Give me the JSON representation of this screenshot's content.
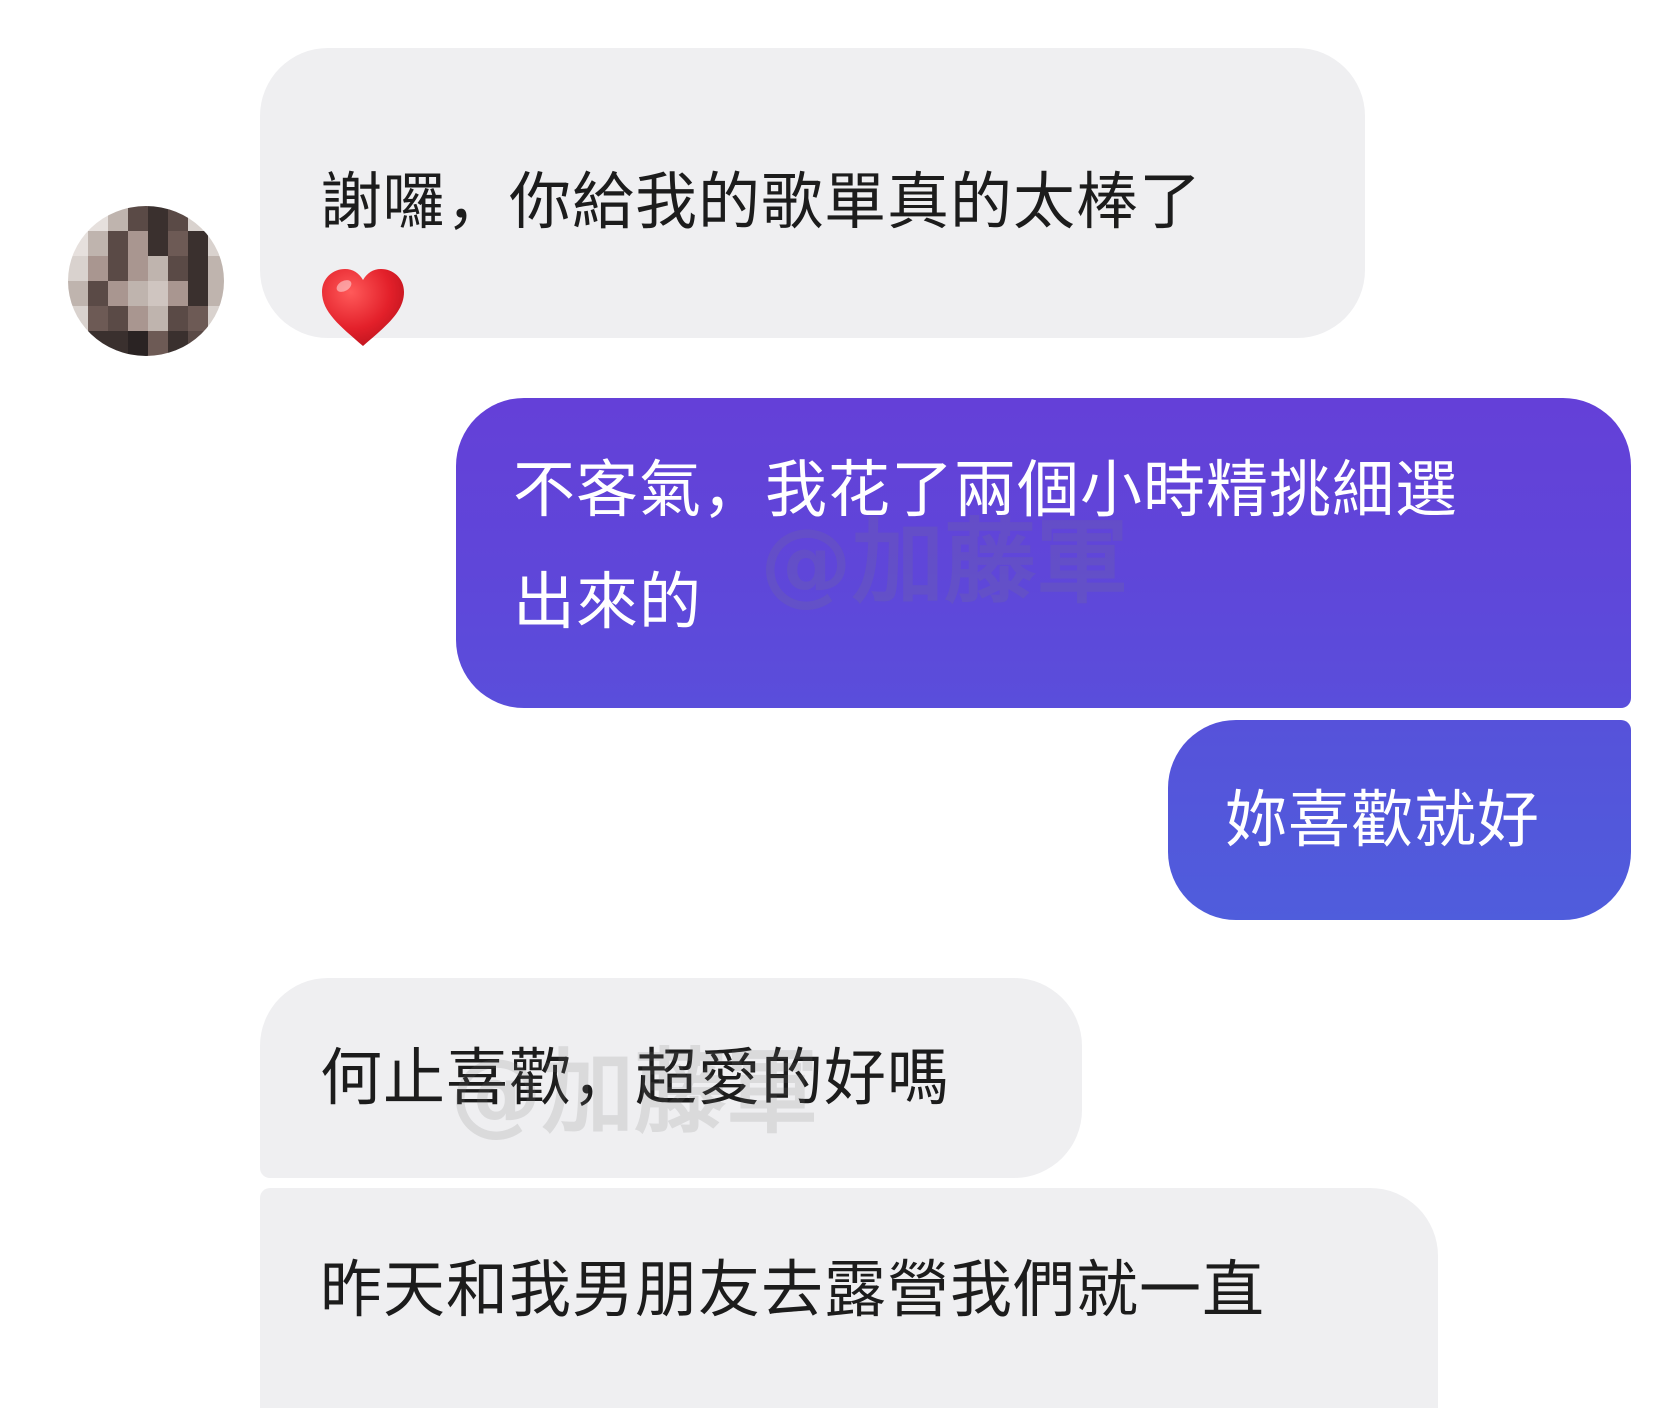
{
  "messages": [
    {
      "direction": "incoming",
      "line1": "謝囉，你給我的歌單真的太棒了",
      "emoji": "heart-emoji"
    },
    {
      "direction": "outgoing",
      "line1": "不客氣，我花了兩個小時精挑細選",
      "line2": "出來的"
    },
    {
      "direction": "outgoing",
      "text": "妳喜歡就好"
    },
    {
      "direction": "incoming",
      "text": "何止喜歡，超愛的好嗎"
    },
    {
      "direction": "incoming",
      "text": "昨天和我男朋友去露營我們就一直"
    }
  ],
  "watermark": "@加藤軍",
  "colors": {
    "incoming_bg": "#efeff1",
    "outgoing_top": "#6440d8",
    "outgoing_bottom": "#4f5ddc",
    "heart": "#e0202c"
  }
}
